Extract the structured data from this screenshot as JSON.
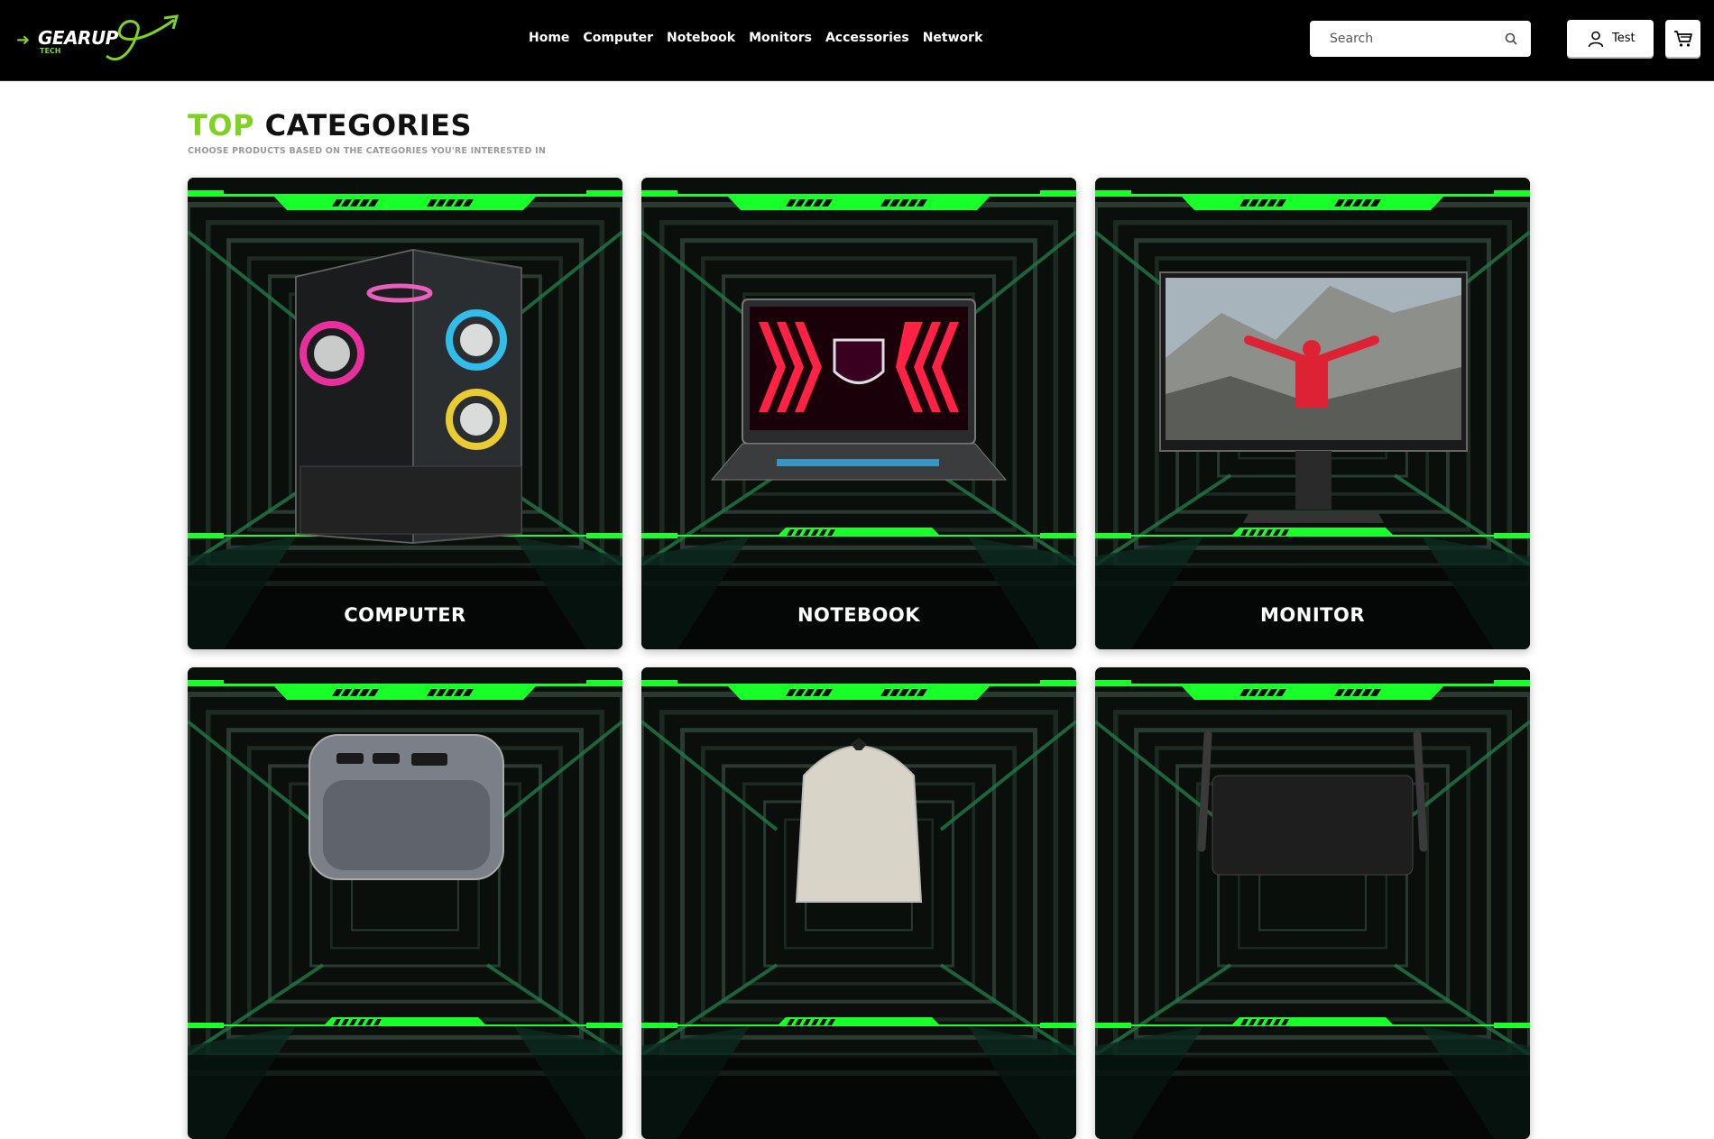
{
  "header": {
    "logo": {
      "brand": "GEARUP",
      "sub": "TECH"
    },
    "nav": [
      "Home",
      "Computer",
      "Notebook",
      "Monitors",
      "Accessories",
      "Network"
    ],
    "search": {
      "placeholder": "Search",
      "value": ""
    },
    "account_label": "Test"
  },
  "section": {
    "title_accent": "TOP",
    "title_rest": "CATEGORIES",
    "subtitle": "CHOOSE PRODUCTS BASED ON THE CATEGORIES YOU'RE INTERESTED IN"
  },
  "categories": [
    {
      "label": "COMPUTER",
      "icon": "pc-case-icon"
    },
    {
      "label": "NOTEBOOK",
      "icon": "laptop-icon"
    },
    {
      "label": "MONITOR",
      "icon": "monitor-icon"
    },
    {
      "label": "",
      "icon": "usb-hub-icon"
    },
    {
      "label": "",
      "icon": "gaming-chair-icon"
    },
    {
      "label": "",
      "icon": "router-icon"
    }
  ],
  "colors": {
    "accent": "#7ed321",
    "neon": "#19ff2a",
    "header_bg": "#000000"
  }
}
